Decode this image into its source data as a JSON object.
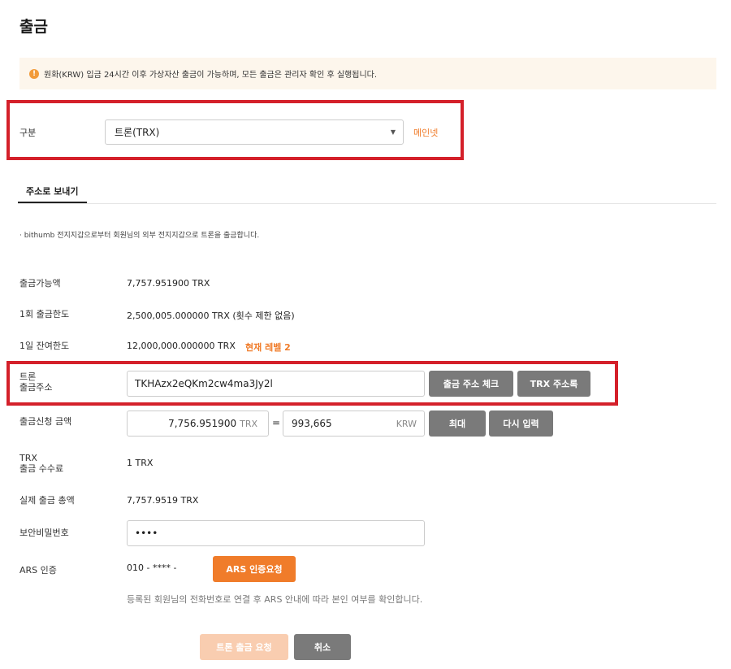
{
  "page": {
    "title": "출금"
  },
  "notice": {
    "icon": "info-icon",
    "text": "원화(KRW) 입금 24시간 이후 가상자산 출금이 가능하며, 모든 출금은 관리자 확인 후 실행됩니다."
  },
  "coin_select": {
    "label": "구분",
    "selected": "트론(TRX)",
    "network_badge": "메인넷"
  },
  "tabs": [
    {
      "label": "주소로 보내기",
      "active": true
    }
  ],
  "description": "bithumb 전지지갑으로부터 회원님의 외부 전지지갑으로 트론을 출금합니다.",
  "info": {
    "available": {
      "label": "출금가능액",
      "value": "7,757.951900 TRX"
    },
    "per_limit": {
      "label": "1회 출금한도",
      "value": "2,500,005.000000 TRX (횟수 제한 없음)"
    },
    "daily_limit": {
      "label": "1일 잔여한도",
      "value": "12,000,000.000000 TRX",
      "level": "현재 레벨 2"
    }
  },
  "address": {
    "label_line1": "트론",
    "label_line2": "출금주소",
    "value": "TKHAzx2eQKm2cw4ma3Jy2l",
    "check_button": "출금 주소 체크",
    "book_button": "TRX 주소록"
  },
  "amount": {
    "label": "출금신청 금액",
    "trx_value": "7,756.951900",
    "trx_unit": "TRX",
    "equals": "=",
    "krw_value": "993,665",
    "krw_unit": "KRW",
    "max_button": "최대",
    "reset_button": "다시 입력"
  },
  "fee": {
    "label_line1": "TRX",
    "label_line2": "출금 수수료",
    "value": "1 TRX"
  },
  "total": {
    "label": "실제 출금 총액",
    "value": "7,757.9519 TRX"
  },
  "password": {
    "label": "보안비밀번호",
    "value": "••••"
  },
  "ars": {
    "label": "ARS 인증",
    "phone": "010 - **** -",
    "button": "ARS 인증요청",
    "help": "등록된 회원님의 전화번호로 연결 후 ARS 안내에 따라 본인 여부를 확인합니다."
  },
  "actions": {
    "submit": "트론 출금 요청",
    "cancel": "취소"
  },
  "colors": {
    "accent": "#f07c2a",
    "highlight_border": "#d4202a",
    "gray_button": "#7a7a7a",
    "notice_bg": "#fdf6ec"
  }
}
